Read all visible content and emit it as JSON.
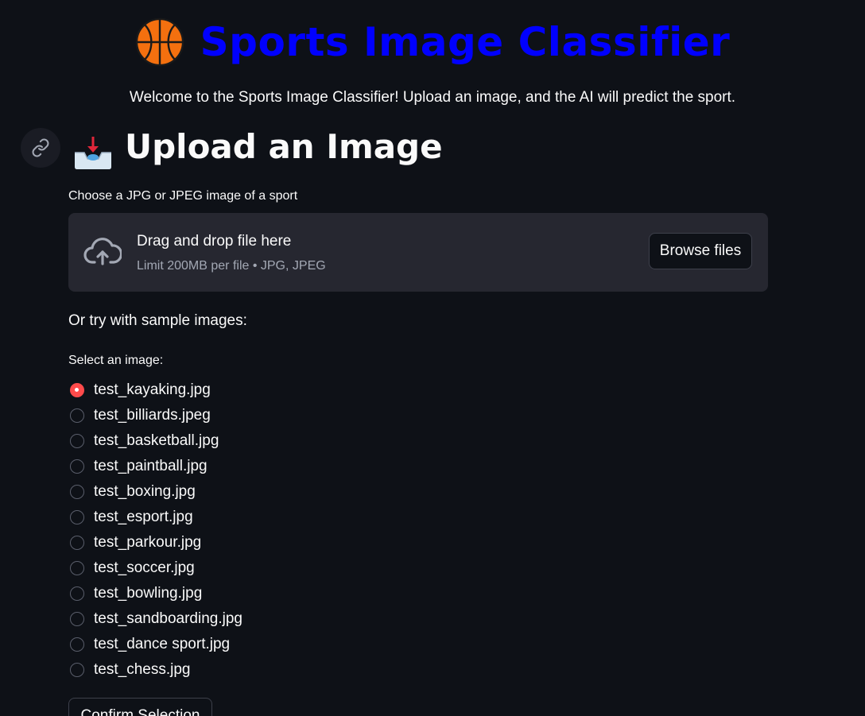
{
  "header": {
    "title": "Sports Image Classifier",
    "title_color": "#0000ff",
    "icon": "basketball-icon",
    "subtitle": "Welcome to the Sports Image Classifier! Upload an image, and the AI will predict the sport."
  },
  "upload_section": {
    "heading": "Upload an Image",
    "heading_icon": "inbox-tray-icon",
    "anchor_icon": "link-icon",
    "file_label": "Choose a JPG or JPEG image of a sport",
    "dropzone": {
      "title": "Drag and drop file here",
      "limit_text": "Limit 200MB per file • JPG, JPEG",
      "icon": "cloud-upload-icon",
      "browse_label": "Browse files"
    }
  },
  "samples": {
    "intro": "Or try with sample images:",
    "select_label": "Select an image:",
    "selected_index": 0,
    "options": [
      "test_kayaking.jpg",
      "test_billiards.jpeg",
      "test_basketball.jpg",
      "test_paintball.jpg",
      "test_boxing.jpg",
      "test_esport.jpg",
      "test_parkour.jpg",
      "test_soccer.jpg",
      "test_bowling.jpg",
      "test_sandboarding.jpg",
      "test_dance sport.jpg",
      "test_chess.jpg"
    ],
    "confirm_label": "Confirm Selection"
  },
  "colors": {
    "background": "#0e1117",
    "accent": "#ff4b4b",
    "dropzone_bg": "#262730"
  }
}
